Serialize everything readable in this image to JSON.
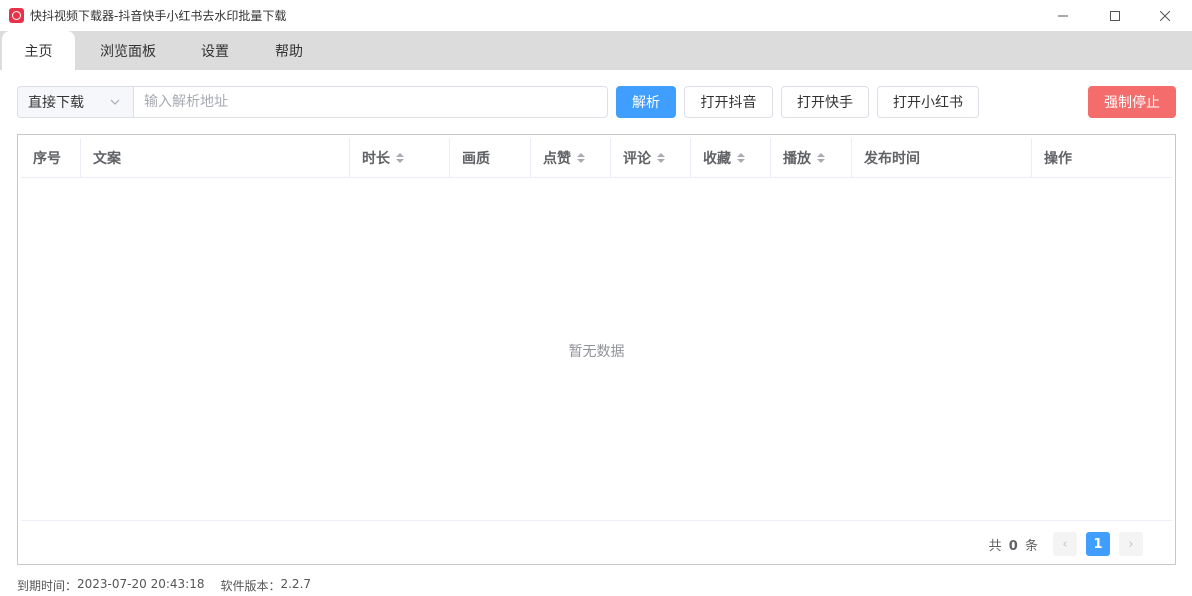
{
  "window": {
    "title": "快抖视频下载器-抖音快手小红书去水印批量下载",
    "icons": {
      "app": "app-logo-icon",
      "minimize": "minimize-icon",
      "maximize": "maximize-icon",
      "close": "close-icon"
    }
  },
  "tabs": [
    {
      "label": "主页",
      "active": true
    },
    {
      "label": "浏览面板",
      "active": false
    },
    {
      "label": "设置",
      "active": false
    },
    {
      "label": "帮助",
      "active": false
    }
  ],
  "toolbar": {
    "mode_select": "直接下载",
    "url_placeholder": "输入解析地址",
    "url_value": "",
    "parse_label": "解析",
    "open_douyin_label": "打开抖音",
    "open_kuaishou_label": "打开快手",
    "open_xhs_label": "打开小红书",
    "force_stop_label": "强制停止"
  },
  "table": {
    "columns": [
      {
        "label": "序号",
        "sortable": false
      },
      {
        "label": "文案",
        "sortable": false
      },
      {
        "label": "时长",
        "sortable": true
      },
      {
        "label": "画质",
        "sortable": false
      },
      {
        "label": "点赞",
        "sortable": true
      },
      {
        "label": "评论",
        "sortable": true
      },
      {
        "label": "收藏",
        "sortable": true
      },
      {
        "label": "播放",
        "sortable": true
      },
      {
        "label": "发布时间",
        "sortable": false
      },
      {
        "label": "操作",
        "sortable": false
      }
    ],
    "rows": [],
    "empty_text": "暂无数据"
  },
  "pagination": {
    "total_prefix": "共",
    "total_count": "0",
    "total_suffix": "条",
    "current_page": "1",
    "prev": "‹",
    "next": "›"
  },
  "status": {
    "expiry_label": "到期时间：",
    "expiry_value": "2023-07-20 20:43:18",
    "version_label": "软件版本：",
    "version_value": "2.2.7"
  },
  "colors": {
    "primary": "#409eff",
    "danger": "#f56c6c",
    "tabbar": "#dcdcdc"
  }
}
